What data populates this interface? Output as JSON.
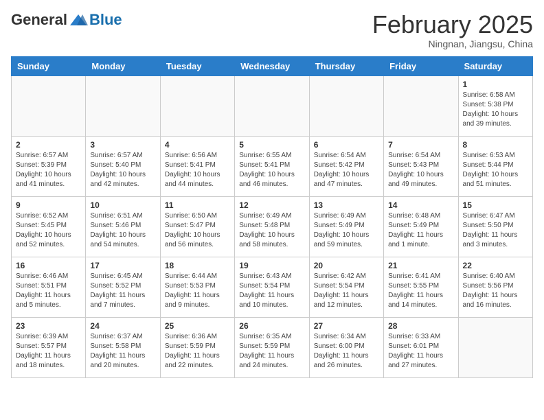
{
  "header": {
    "logo_general": "General",
    "logo_blue": "Blue",
    "month_title": "February 2025",
    "subtitle": "Ningnan, Jiangsu, China"
  },
  "weekdays": [
    "Sunday",
    "Monday",
    "Tuesday",
    "Wednesday",
    "Thursday",
    "Friday",
    "Saturday"
  ],
  "weeks": [
    [
      {
        "day": "",
        "info": ""
      },
      {
        "day": "",
        "info": ""
      },
      {
        "day": "",
        "info": ""
      },
      {
        "day": "",
        "info": ""
      },
      {
        "day": "",
        "info": ""
      },
      {
        "day": "",
        "info": ""
      },
      {
        "day": "1",
        "info": "Sunrise: 6:58 AM\nSunset: 5:38 PM\nDaylight: 10 hours and 39 minutes."
      }
    ],
    [
      {
        "day": "2",
        "info": "Sunrise: 6:57 AM\nSunset: 5:39 PM\nDaylight: 10 hours and 41 minutes."
      },
      {
        "day": "3",
        "info": "Sunrise: 6:57 AM\nSunset: 5:40 PM\nDaylight: 10 hours and 42 minutes."
      },
      {
        "day": "4",
        "info": "Sunrise: 6:56 AM\nSunset: 5:41 PM\nDaylight: 10 hours and 44 minutes."
      },
      {
        "day": "5",
        "info": "Sunrise: 6:55 AM\nSunset: 5:41 PM\nDaylight: 10 hours and 46 minutes."
      },
      {
        "day": "6",
        "info": "Sunrise: 6:54 AM\nSunset: 5:42 PM\nDaylight: 10 hours and 47 minutes."
      },
      {
        "day": "7",
        "info": "Sunrise: 6:54 AM\nSunset: 5:43 PM\nDaylight: 10 hours and 49 minutes."
      },
      {
        "day": "8",
        "info": "Sunrise: 6:53 AM\nSunset: 5:44 PM\nDaylight: 10 hours and 51 minutes."
      }
    ],
    [
      {
        "day": "9",
        "info": "Sunrise: 6:52 AM\nSunset: 5:45 PM\nDaylight: 10 hours and 52 minutes."
      },
      {
        "day": "10",
        "info": "Sunrise: 6:51 AM\nSunset: 5:46 PM\nDaylight: 10 hours and 54 minutes."
      },
      {
        "day": "11",
        "info": "Sunrise: 6:50 AM\nSunset: 5:47 PM\nDaylight: 10 hours and 56 minutes."
      },
      {
        "day": "12",
        "info": "Sunrise: 6:49 AM\nSunset: 5:48 PM\nDaylight: 10 hours and 58 minutes."
      },
      {
        "day": "13",
        "info": "Sunrise: 6:49 AM\nSunset: 5:49 PM\nDaylight: 10 hours and 59 minutes."
      },
      {
        "day": "14",
        "info": "Sunrise: 6:48 AM\nSunset: 5:49 PM\nDaylight: 11 hours and 1 minute."
      },
      {
        "day": "15",
        "info": "Sunrise: 6:47 AM\nSunset: 5:50 PM\nDaylight: 11 hours and 3 minutes."
      }
    ],
    [
      {
        "day": "16",
        "info": "Sunrise: 6:46 AM\nSunset: 5:51 PM\nDaylight: 11 hours and 5 minutes."
      },
      {
        "day": "17",
        "info": "Sunrise: 6:45 AM\nSunset: 5:52 PM\nDaylight: 11 hours and 7 minutes."
      },
      {
        "day": "18",
        "info": "Sunrise: 6:44 AM\nSunset: 5:53 PM\nDaylight: 11 hours and 9 minutes."
      },
      {
        "day": "19",
        "info": "Sunrise: 6:43 AM\nSunset: 5:54 PM\nDaylight: 11 hours and 10 minutes."
      },
      {
        "day": "20",
        "info": "Sunrise: 6:42 AM\nSunset: 5:54 PM\nDaylight: 11 hours and 12 minutes."
      },
      {
        "day": "21",
        "info": "Sunrise: 6:41 AM\nSunset: 5:55 PM\nDaylight: 11 hours and 14 minutes."
      },
      {
        "day": "22",
        "info": "Sunrise: 6:40 AM\nSunset: 5:56 PM\nDaylight: 11 hours and 16 minutes."
      }
    ],
    [
      {
        "day": "23",
        "info": "Sunrise: 6:39 AM\nSunset: 5:57 PM\nDaylight: 11 hours and 18 minutes."
      },
      {
        "day": "24",
        "info": "Sunrise: 6:37 AM\nSunset: 5:58 PM\nDaylight: 11 hours and 20 minutes."
      },
      {
        "day": "25",
        "info": "Sunrise: 6:36 AM\nSunset: 5:59 PM\nDaylight: 11 hours and 22 minutes."
      },
      {
        "day": "26",
        "info": "Sunrise: 6:35 AM\nSunset: 5:59 PM\nDaylight: 11 hours and 24 minutes."
      },
      {
        "day": "27",
        "info": "Sunrise: 6:34 AM\nSunset: 6:00 PM\nDaylight: 11 hours and 26 minutes."
      },
      {
        "day": "28",
        "info": "Sunrise: 6:33 AM\nSunset: 6:01 PM\nDaylight: 11 hours and 27 minutes."
      },
      {
        "day": "",
        "info": ""
      }
    ]
  ]
}
